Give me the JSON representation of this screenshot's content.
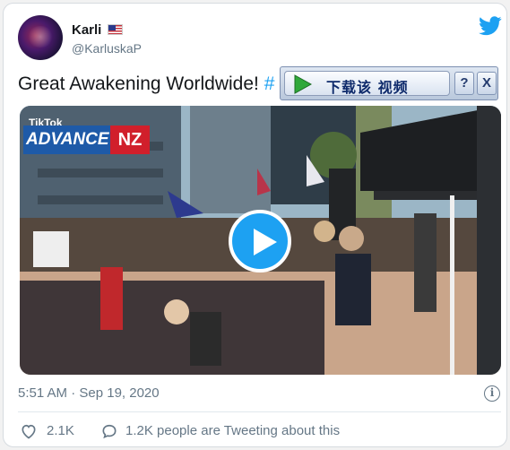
{
  "user": {
    "display_name": "Karli",
    "handle": "@KarluskaP",
    "flag_icon": "us-flag-icon"
  },
  "tweet": {
    "text": "Great Awakening Worldwide! ",
    "hashtag_fragment": "#"
  },
  "download_toolbar": {
    "label": "下载该 视频",
    "help_label": "?",
    "close_label": "X"
  },
  "video": {
    "logo_small": "TikTok",
    "logo_main": "ADVANCE",
    "logo_badge": "NZ",
    "brand_blue": "#1e5aa8",
    "brand_red": "#d11f2b"
  },
  "meta": {
    "timestamp": "5:51 AM · Sep 19, 2020",
    "info_label": "i"
  },
  "engagement": {
    "likes": "2.1K",
    "tweeting": "1.2K people are Tweeting about this"
  },
  "colors": {
    "accent": "#1da1f2",
    "muted_text": "#657786"
  }
}
